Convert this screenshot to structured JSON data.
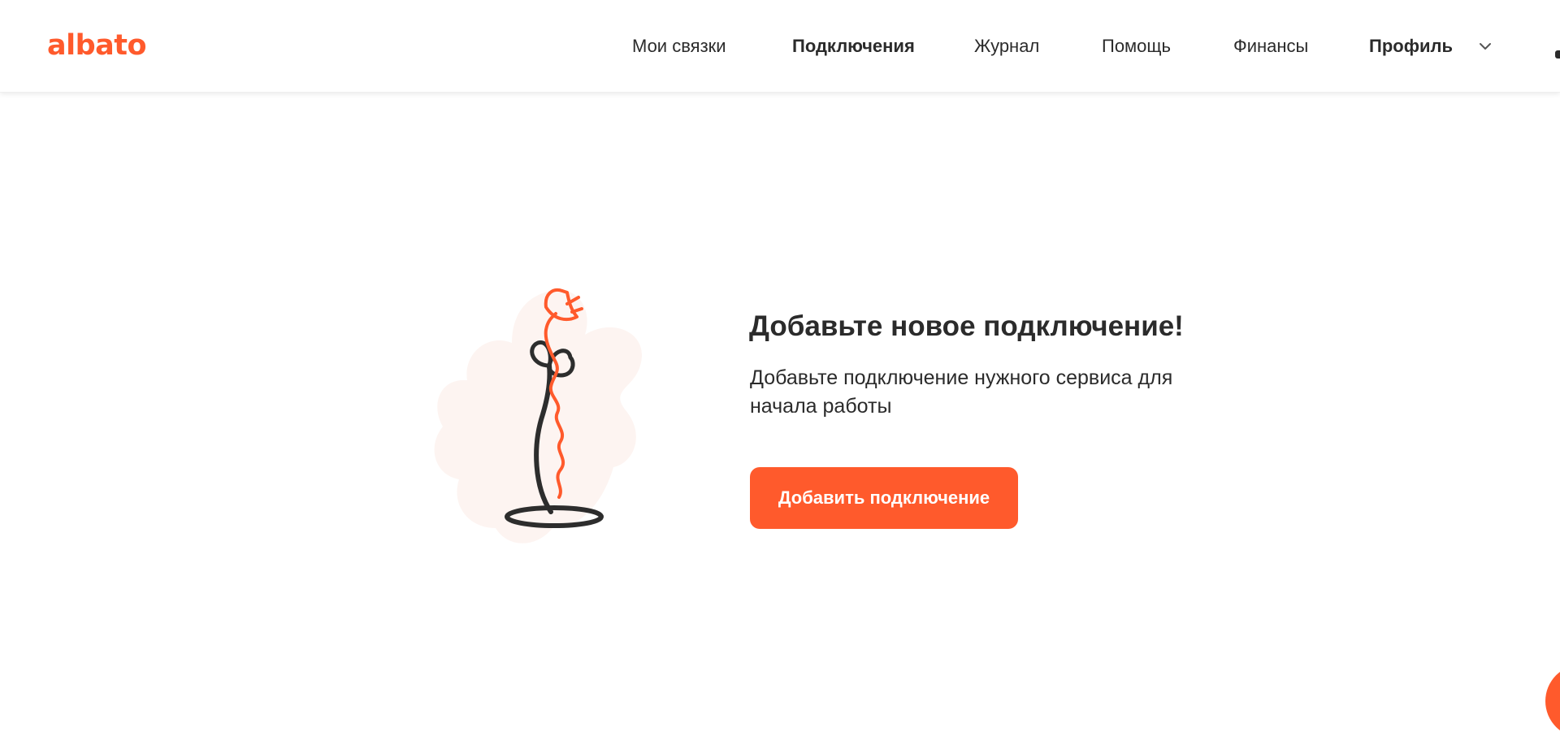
{
  "brand": {
    "logo_text": "albato",
    "accent_color": "#ff5a2c"
  },
  "nav": {
    "items": [
      {
        "label": "Мои связки",
        "active": false
      },
      {
        "label": "Подключения",
        "active": true
      },
      {
        "label": "Журнал",
        "active": false
      },
      {
        "label": "Помощь",
        "active": false
      },
      {
        "label": "Финансы",
        "active": false
      }
    ],
    "profile_label": "Профиль",
    "profile_icon": "chevron-down-icon"
  },
  "empty_state": {
    "title": "Добавьте новое подключение!",
    "description": "Добавьте подключение нужного сервиса для начала работы",
    "button_label": "Добавить подключение",
    "illustration": "lamp-plug-illustration"
  },
  "chat_widget": {
    "icon": "chat-bubble-icon"
  }
}
